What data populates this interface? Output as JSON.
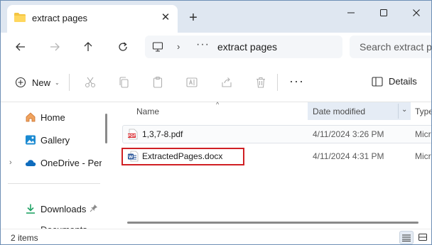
{
  "tab": {
    "title": "extract pages",
    "close_symbol": "✕",
    "new_tab_symbol": "+"
  },
  "address": {
    "path_segment": "extract pages",
    "separator": "›",
    "overflow": "···"
  },
  "search": {
    "placeholder": "Search extract pages"
  },
  "toolbar": {
    "new_label": "New",
    "new_caret": "⌄",
    "more": "···",
    "details_label": "Details"
  },
  "sidebar": {
    "items": [
      {
        "label": "Home",
        "icon": "home-icon"
      },
      {
        "label": "Gallery",
        "icon": "gallery-icon"
      },
      {
        "label": "OneDrive - Personal",
        "icon": "cloud-icon",
        "expander": "›"
      },
      {
        "label": "Downloads",
        "icon": "download-icon",
        "pinned": true
      },
      {
        "label": "Documents",
        "icon": "document-icon"
      }
    ]
  },
  "columns": {
    "name": "Name",
    "date": "Date modified",
    "type": "Type",
    "sort_indicator": "^",
    "date_caret": "⌄"
  },
  "files": [
    {
      "name": "1,3,7-8.pdf",
      "date": "4/11/2024 3:26 PM",
      "type": "Microsoft Edge PDF Document",
      "icon": "pdf-icon"
    },
    {
      "name": "ExtractedPages.docx",
      "date": "4/11/2024 4:31 PM",
      "type": "Microsoft Word Document",
      "icon": "word-icon",
      "highlighted": true
    }
  ],
  "status": {
    "item_count": "2 items"
  },
  "colors": {
    "titlebar": "#dfe7f1",
    "highlight": "#d02024",
    "folder": "#f4c542",
    "pdf": "#d8262c",
    "word": "#2b579a",
    "accent": "#0067c0"
  }
}
